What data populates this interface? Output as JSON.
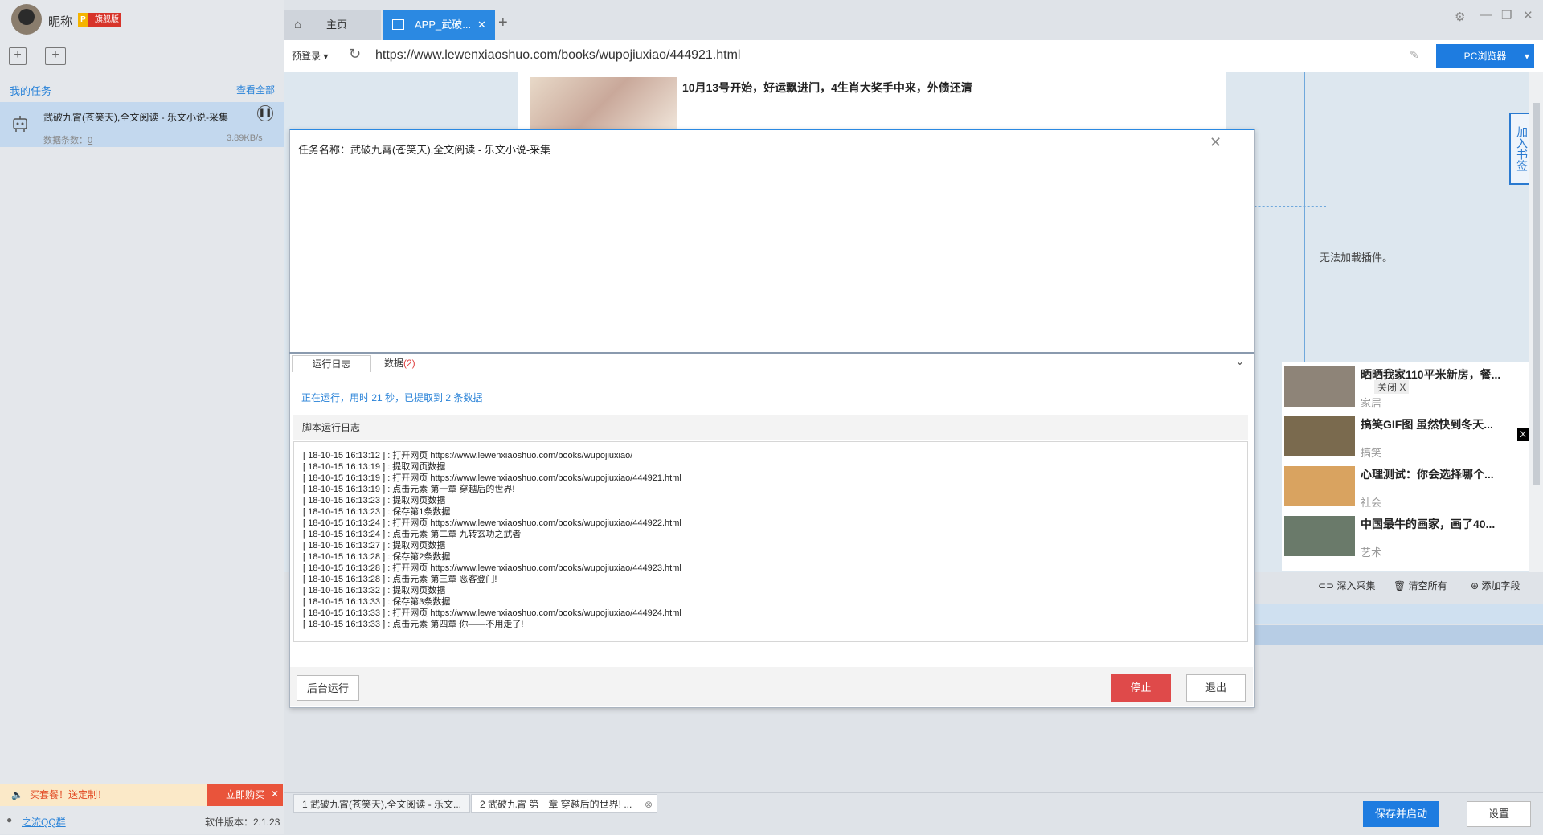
{
  "sidebar": {
    "nickname": "昵称",
    "vip_badge": "旗舰版",
    "my_tasks_label": "我的任务",
    "view_all_label": "查看全部",
    "task": {
      "name": "武破九霄(苍笑天),全文阅读 - 乐文小说-采集",
      "count_label": "数据条数：",
      "count": "0",
      "speed": "3.89KB/s"
    },
    "promo_text": "买套餐！送定制！",
    "buy_now_label": "立即购买",
    "qq_group_label": "之流QQ群",
    "version_label": "软件版本：2.1.23"
  },
  "tabs": {
    "home_label": "主页",
    "app_label": "APP_武破..."
  },
  "addressbar": {
    "prelogin_label": "预登录",
    "url": "https://www.lewenxiaoshuo.com/books/wupojiuxiao/444921.html",
    "pc_browser_label": "PC浏览器"
  },
  "page": {
    "article_title": "10月13号开始，好运飘进门，4生肖大奖手中来，外债还清",
    "plugin_msg": "无法加载插件。",
    "bookmark_label": "加入书签",
    "close_label": "关闭 X",
    "news": [
      {
        "title": "晒晒我家110平米新房，餐...",
        "tag": "家居"
      },
      {
        "title": "搞笑GIF图 虽然快到冬天...",
        "tag": "搞笑"
      },
      {
        "title": "心理测试：你会选择哪个...",
        "tag": "社会"
      },
      {
        "title": "中国最牛的画家，画了40...",
        "tag": "艺术"
      }
    ],
    "tools": {
      "deep_collect": "深入采集",
      "clear_all": "清空所有",
      "add_field": "添加字段"
    }
  },
  "modal": {
    "task_name_label": "任务名称：武破九霄(苍笑天),全文阅读 - 乐文小说-采集",
    "tab_log_label": "运行日志",
    "tab_data_label": "数据",
    "tab_data_count": "(2)",
    "status_text": "正在运行，用时 21 秒，已提取到 2 条数据",
    "log_header": "脚本运行日志",
    "log_lines": [
      "[ 18-10-15 16:13:12 ] : 打开网页 https://www.lewenxiaoshuo.com/books/wupojiuxiao/",
      "[ 18-10-15 16:13:19 ] : 提取网页数据",
      "[ 18-10-15 16:13:19 ] : 打开网页 https://www.lewenxiaoshuo.com/books/wupojiuxiao/444921.html",
      "[ 18-10-15 16:13:19 ] : 点击元素 第一章 穿越后的世界!",
      "[ 18-10-15 16:13:23 ] : 提取网页数据",
      "[ 18-10-15 16:13:23 ] : 保存第1条数据",
      "[ 18-10-15 16:13:24 ] : 打开网页 https://www.lewenxiaoshuo.com/books/wupojiuxiao/444922.html",
      "[ 18-10-15 16:13:24 ] : 点击元素 第二章 九转玄功之武者",
      "[ 18-10-15 16:13:27 ] : 提取网页数据",
      "[ 18-10-15 16:13:28 ] : 保存第2条数据",
      "[ 18-10-15 16:13:28 ] : 打开网页 https://www.lewenxiaoshuo.com/books/wupojiuxiao/444923.html",
      "[ 18-10-15 16:13:28 ] : 点击元素 第三章 恶客登门!",
      "[ 18-10-15 16:13:32 ] : 提取网页数据",
      "[ 18-10-15 16:13:33 ] : 保存第3条数据",
      "[ 18-10-15 16:13:33 ] : 打开网页 https://www.lewenxiaoshuo.com/books/wupojiuxiao/444924.html",
      "[ 18-10-15 16:13:33 ] : 点击元素 第四章 你——不用走了!"
    ],
    "bg_run_label": "后台运行",
    "stop_label": "停止",
    "exit_label": "退出"
  },
  "bottom": {
    "tab1": "1 武破九霄(苍笑天),全文阅读 - 乐文...",
    "tab2": "2 武破九霄 第一章 穿越后的世界! ...",
    "save_start_label": "保存并启动",
    "settings_label": "设置"
  },
  "colors": {
    "accent_blue": "#1e7ce0",
    "stop_red": "#df4a4a",
    "promo_bg": "#fbe9c8"
  }
}
